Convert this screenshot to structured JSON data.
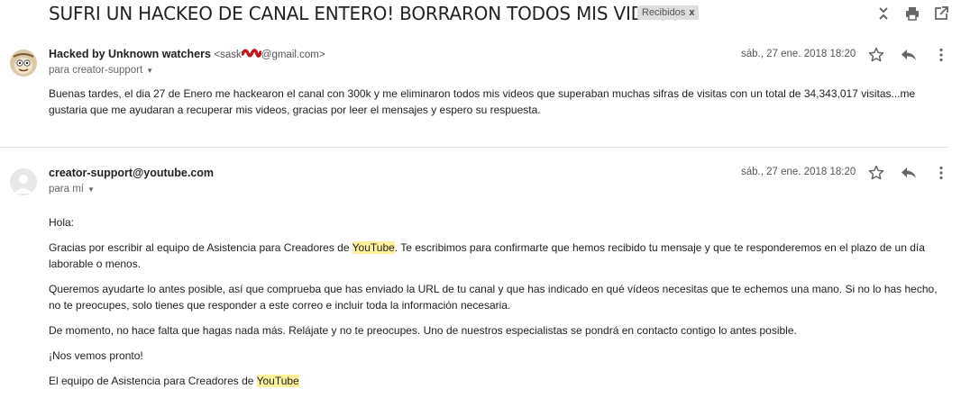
{
  "email": {
    "subject": "SUFRI UN HACKEO DE CANAL ENTERO! BORRARON TODOS MIS VIDEOS",
    "label": "Recibidos",
    "label_close": "x"
  },
  "toolbar": {
    "icons": [
      "expand-collapse-icon",
      "print-icon",
      "open-new-window-icon"
    ]
  },
  "message1": {
    "sender_name": "Hacked by Unknown watchers",
    "sender_email_prefix": "<sask",
    "sender_email_suffix": "@gmail.com>",
    "to": "para creator-support",
    "date": "sáb., 27 ene. 2018 18:20",
    "body": "Buenas tardes, el dia 27 de Enero me hackearon el canal con 300k y me eliminaron todos mis videos que superaban muchas sifras de visitas con un total de 34,343,017 visitas...me gustaria que me ayudaran a recuperar mis videos, gracias por leer el mensajes y espero su respuesta."
  },
  "message2": {
    "sender_name": "creator-support@youtube.com",
    "to": "para mí",
    "date": "sáb., 27 ene. 2018 18:20",
    "greeting": "Hola:",
    "p1_before": "Gracias por escribir al equipo de Asistencia para Creadores de ",
    "p1_highlight": "YouTube",
    "p1_after": ". Te escribimos para confirmarte que hemos recibido tu mensaje y que te responderemos en el plazo de un día laborable o menos.",
    "p2": "Queremos ayudarte lo antes posible, así que comprueba que has enviado la URL de tu canal y que has indicado en qué vídeos necesitas que te echemos una mano. Si no lo has hecho, no te preocupes, solo tienes que responder a este correo e incluir toda la información necesaria.",
    "p3": "De momento, no hace falta que hagas nada más. Relájate y no te preocupes. Uno de nuestros especialistas se pondrá en contacto contigo lo antes posible.",
    "p4": "¡Nos vemos pronto!",
    "signature_before": "El equipo de Asistencia para Creadores de ",
    "signature_highlight": "YouTube"
  },
  "colors": {
    "highlight": "#fdf29b",
    "label_bg": "#dddddd",
    "redaction": "#c0181d"
  }
}
